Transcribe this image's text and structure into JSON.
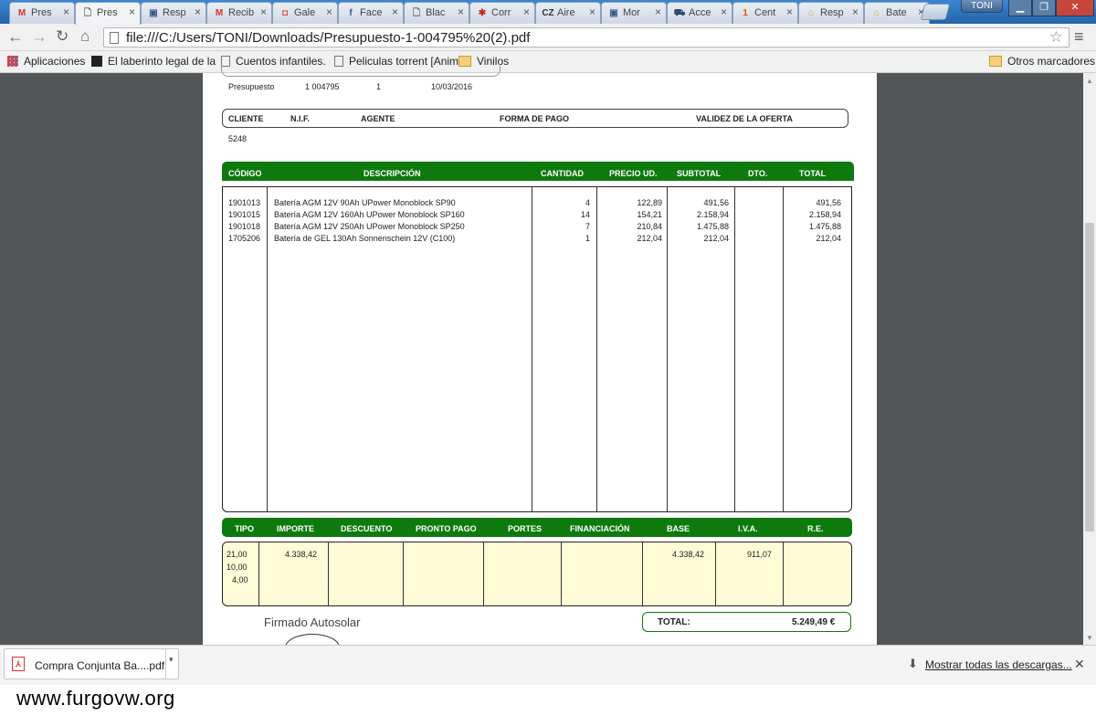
{
  "browser": {
    "tabs": [
      {
        "label": "Pres",
        "icon": "gmail-icon",
        "color": "#d93025",
        "glyph": "M"
      },
      {
        "label": "Pres",
        "icon": "page-icon",
        "color": "#666666",
        "glyph": "🗋"
      },
      {
        "label": "Resp",
        "icon": "image-icon",
        "color": "#3b5b8c",
        "glyph": "▣"
      },
      {
        "label": "Recib",
        "icon": "gmail-icon",
        "color": "#d93025",
        "glyph": "M"
      },
      {
        "label": "Gale",
        "icon": "red-square-icon",
        "color": "#e0452b",
        "glyph": "◘"
      },
      {
        "label": "Face",
        "icon": "facebook-icon",
        "color": "#3b5998",
        "glyph": "f"
      },
      {
        "label": "Blac",
        "icon": "page-icon",
        "color": "#666666",
        "glyph": "🗋"
      },
      {
        "label": "Corr",
        "icon": "gear-red-icon",
        "color": "#c62828",
        "glyph": "✱"
      },
      {
        "label": "Aire",
        "icon": "cz-icon",
        "color": "#333333",
        "glyph": "CZ"
      },
      {
        "label": "Mor",
        "icon": "image-icon",
        "color": "#3b5b8c",
        "glyph": "▣"
      },
      {
        "label": "Acce",
        "icon": "car-icon",
        "color": "#2b4a73",
        "glyph": "⛟"
      },
      {
        "label": "Cent",
        "icon": "one-icon",
        "color": "#e65100",
        "glyph": "1"
      },
      {
        "label": "Resp",
        "icon": "home-icon",
        "color": "#e6a800",
        "glyph": "⌂"
      },
      {
        "label": "Bate",
        "icon": "home-icon",
        "color": "#e6a800",
        "glyph": "⌂"
      }
    ],
    "user": "TONI",
    "url": "file:///C:/Users/TONI/Downloads/Presupuesto-1-004795%20(2).pdf",
    "bookmarks": [
      {
        "label": "Aplicaciones",
        "icon": "apps-icon"
      },
      {
        "label": "El laberinto legal de la",
        "icon": "ds-icon"
      },
      {
        "label": "Cuentos infantiles.",
        "icon": "page-icon"
      },
      {
        "label": "Peliculas torrent [Anim",
        "icon": "page-icon"
      },
      {
        "label": "Vinilos",
        "icon": "folder-icon"
      }
    ],
    "other_bookmarks": "Otros marcadores"
  },
  "doc": {
    "meta": {
      "label": "Presupuesto",
      "number": "1  004795",
      "version": "1",
      "date": "10/03/2016"
    },
    "client_headers": [
      "CLIENTE",
      "N.I.F.",
      "AGENTE",
      "FORMA DE PAGO",
      "VALIDEZ DE LA OFERTA"
    ],
    "client_value": "5248",
    "item_headers": [
      "CÓDIGO",
      "DESCRIPCIÓN",
      "CANTIDAD",
      "PRECIO UD.",
      "SUBTOTAL",
      "DTO.",
      "TOTAL"
    ],
    "items": [
      {
        "code": "1901013",
        "desc": "Batería AGM 12V 90Ah UPower Monoblock SP90",
        "qty": "4",
        "price": "122,89",
        "subtotal": "491,56",
        "dto": "",
        "total": "491,56"
      },
      {
        "code": "1901015",
        "desc": "Batería AGM 12V 160Ah UPower Monoblock SP160",
        "qty": "14",
        "price": "154,21",
        "subtotal": "2.158,94",
        "dto": "",
        "total": "2.158,94"
      },
      {
        "code": "1901018",
        "desc": "Batería AGM 12V 250Ah UPower Monoblock SP250",
        "qty": "7",
        "price": "210,84",
        "subtotal": "1.475,88",
        "dto": "",
        "total": "1.475,88"
      },
      {
        "code": "1705206",
        "desc": "Batería de GEL 130Ah Sonnenschein 12V (C100)",
        "qty": "1",
        "price": "212,04",
        "subtotal": "212,04",
        "dto": "",
        "total": "212,04"
      }
    ],
    "tax_headers": [
      "TIPO",
      "IMPORTE",
      "DESCUENTO",
      "PRONTO PAGO",
      "PORTES",
      "FINANCIACIÓN",
      "BASE",
      "I.V.A.",
      "R.E."
    ],
    "tax_types": [
      "21,00",
      "10,00",
      "4,00"
    ],
    "tax_importe": "4.338,42",
    "tax_base": "4.338,42",
    "tax_iva": "911,07",
    "signature": "Firmado Autosolar",
    "total_label": "TOTAL:",
    "total_value": "5.249,49  €"
  },
  "downloads": {
    "file": "Compra Conjunta Ba....pdf",
    "show_all": "Mostrar todas las descargas..."
  },
  "watermark": "www.furgovw.org",
  "colors": {
    "green": "#0e7a0e",
    "tax_bg": "#fffbd6",
    "viewer_bg": "#525659"
  }
}
